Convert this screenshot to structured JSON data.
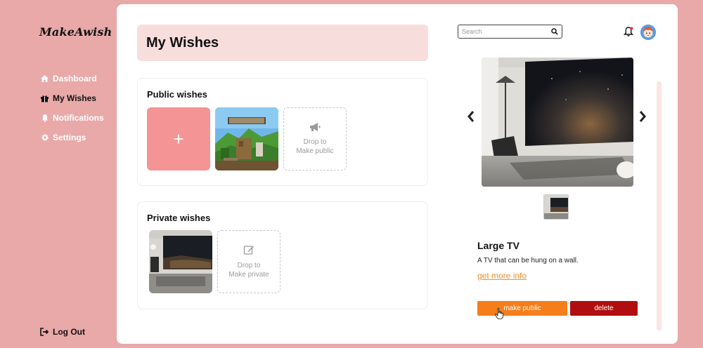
{
  "app": {
    "logo": "MakeAwish"
  },
  "sidebar": {
    "items": [
      {
        "label": "Dashboard",
        "icon": "home-icon",
        "active": false
      },
      {
        "label": "My Wishes",
        "icon": "gift-icon",
        "active": true
      },
      {
        "label": "Notifications",
        "icon": "bell-icon",
        "active": false
      },
      {
        "label": "Settings",
        "icon": "gear-icon",
        "active": false
      }
    ],
    "logout": "Log Out"
  },
  "page": {
    "title": "My Wishes"
  },
  "public_wishes": {
    "title": "Public wishes",
    "add_label": "+",
    "drop_text_1": "Drop to",
    "drop_text_2": "Make public"
  },
  "private_wishes": {
    "title": "Private wishes",
    "drop_text_1": "Drop to",
    "drop_text_2": "Make private"
  },
  "search": {
    "placeholder": "Search"
  },
  "detail": {
    "name": "Large TV",
    "description": "A TV that can be hung on a wall.",
    "link": "get more info",
    "make_public": "make public",
    "delete": "delete"
  },
  "colors": {
    "background": "#e8a9a8",
    "accent_pink": "#f59494",
    "title_bg": "#f7dedd",
    "orange": "#f57e1a",
    "red": "#b10f0f"
  }
}
